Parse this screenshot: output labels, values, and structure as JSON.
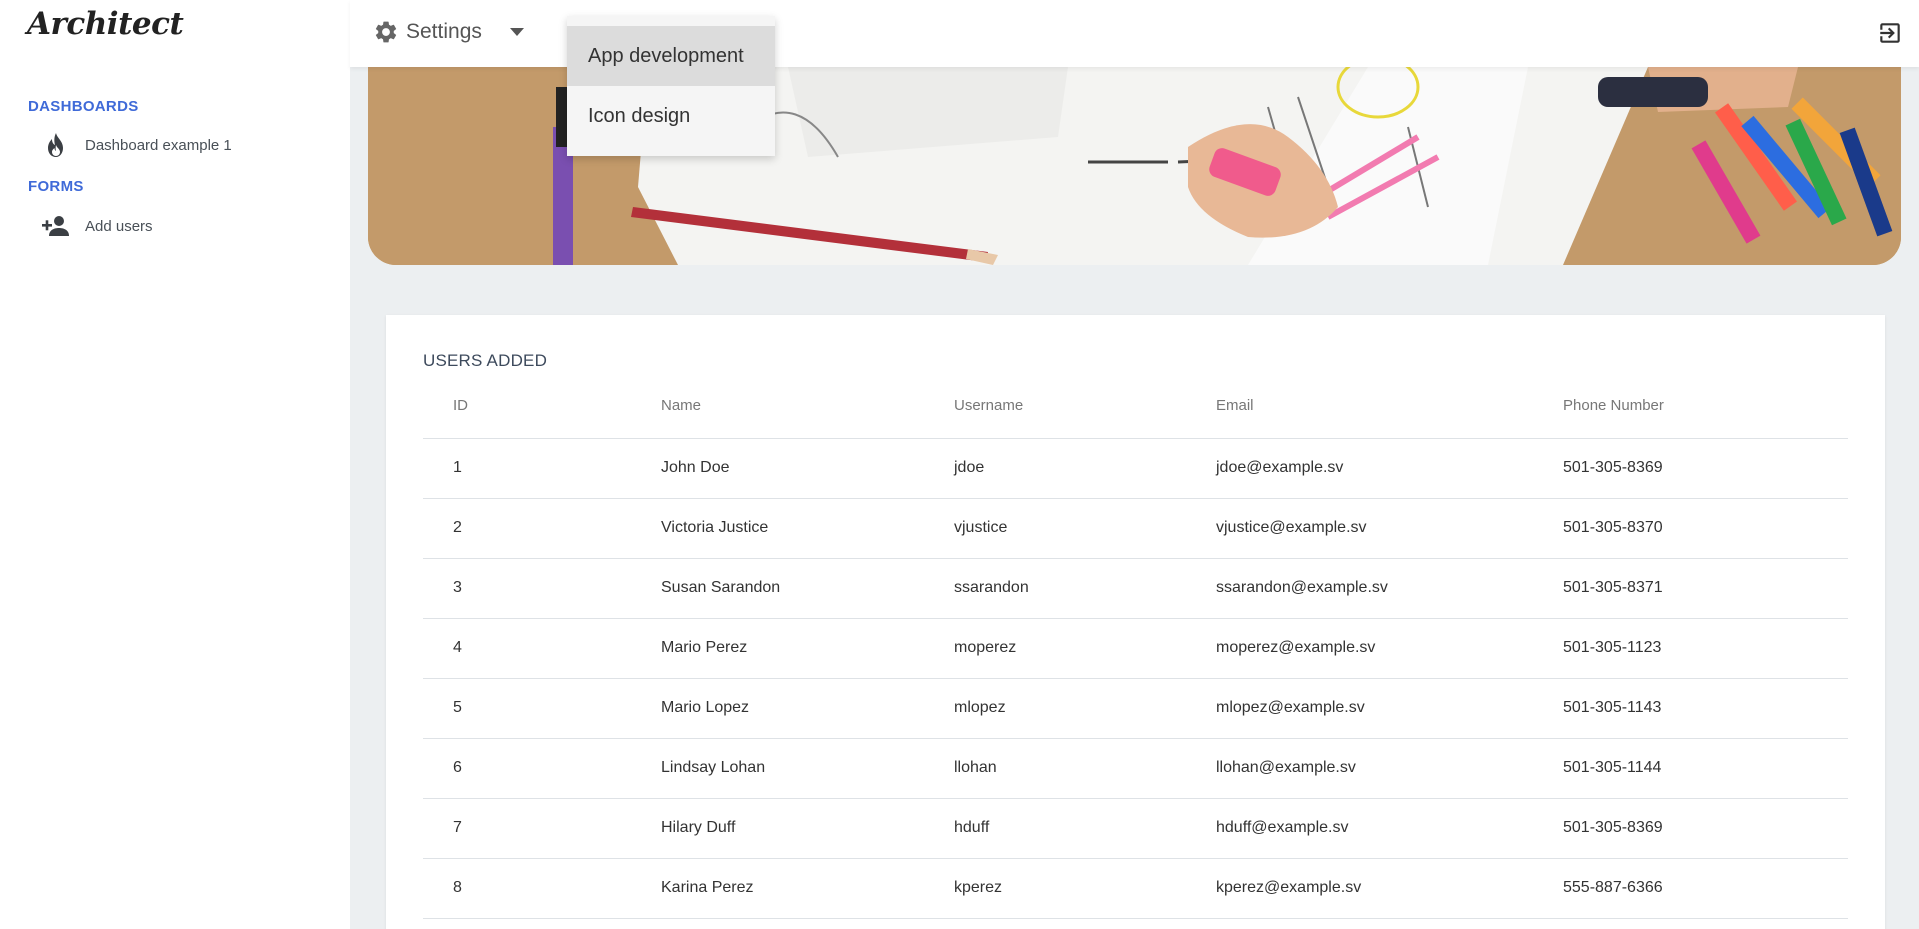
{
  "app": {
    "logo": "Architect"
  },
  "sidebar": {
    "sections": [
      {
        "title": "DASHBOARDS",
        "items": [
          {
            "label": "Dashboard example 1",
            "icon": "flame-icon"
          }
        ]
      },
      {
        "title": "FORMS",
        "items": [
          {
            "label": "Add users",
            "icon": "person-add-icon"
          }
        ]
      }
    ]
  },
  "header": {
    "settings_label": "Settings",
    "settings_icon": "gear-icon",
    "dropdown_icon": "caret-down-icon",
    "logout_icon": "logout-icon"
  },
  "dropdown": {
    "items": [
      {
        "label": "App development",
        "highlighted": true
      },
      {
        "label": "Icon design",
        "highlighted": false
      }
    ]
  },
  "users_table": {
    "title": "USERS ADDED",
    "columns": [
      "ID",
      "Name",
      "Username",
      "Email",
      "Phone Number"
    ],
    "rows": [
      [
        "1",
        "John Doe",
        "jdoe",
        "jdoe@example.sv",
        "501-305-8369"
      ],
      [
        "2",
        "Victoria Justice",
        "vjustice",
        "vjustice@example.sv",
        "501-305-8370"
      ],
      [
        "3",
        "Susan Sarandon",
        "ssarandon",
        "ssarandon@example.sv",
        "501-305-8371"
      ],
      [
        "4",
        "Mario Perez",
        "moperez",
        "moperez@example.sv",
        "501-305-1123"
      ],
      [
        "5",
        "Mario Lopez",
        "mlopez",
        "mlopez@example.sv",
        "501-305-1143"
      ],
      [
        "6",
        "Lindsay Lohan",
        "llohan",
        "llohan@example.sv",
        "501-305-1144"
      ],
      [
        "7",
        "Hilary Duff",
        "hduff",
        "hduff@example.sv",
        "501-305-8369"
      ],
      [
        "8",
        "Karina Perez",
        "kperez",
        "kperez@example.sv",
        "555-887-6366"
      ]
    ]
  },
  "colors": {
    "accent": "#3f6ad8",
    "background": "#eceff1",
    "menu_highlight": "#dcdcdc"
  }
}
